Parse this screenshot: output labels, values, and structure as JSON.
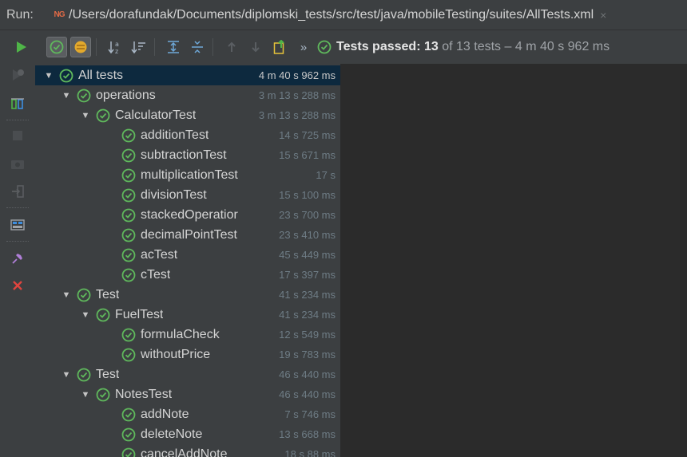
{
  "run_header": {
    "label": "Run:",
    "app_badge": "NG",
    "path": "/Users/dorafundak/Documents/diplomski_tests/src/test/java/mobileTesting/suites/AllTests.xml",
    "close_glyph": "×"
  },
  "toolbar": {
    "icons": [
      "run-icon",
      "show-passed-icon",
      "show-ignored-icon",
      "sort-alpha-icon",
      "sort-duration-icon",
      "expand-all-icon",
      "collapse-all-icon",
      "prev-failed-icon",
      "next-failed-icon",
      "export-icon",
      "more-icon"
    ],
    "more_glyph": "»",
    "status_prefix": "Tests passed:",
    "status_passed": "13",
    "status_suffix": "of 13 tests – 4 m 40 s 962 ms"
  },
  "gutter": {
    "icons": [
      "rerun-failed-icon",
      "toggle-auto-test-icon",
      "stop-icon",
      "screenshot-icon",
      "exit-icon",
      "layout-icon",
      "pin-icon",
      "close-icon"
    ]
  },
  "tree": {
    "rows": [
      {
        "level": 0,
        "arrow": "▼",
        "name": "All tests",
        "time": "4 m 40 s 962 ms",
        "selected": true
      },
      {
        "level": 1,
        "arrow": "▼",
        "name": "operations",
        "time": "3 m 13 s 288 ms"
      },
      {
        "level": 2,
        "arrow": "▼",
        "name": "CalculatorTest",
        "time": "3 m 13 s 288 ms"
      },
      {
        "level": 3,
        "arrow": "",
        "name": "additionTest",
        "time": "14 s 725 ms"
      },
      {
        "level": 3,
        "arrow": "",
        "name": "subtractionTest",
        "time": "15 s 671 ms"
      },
      {
        "level": 3,
        "arrow": "",
        "name": "multiplicationTest",
        "time": "17 s"
      },
      {
        "level": 3,
        "arrow": "",
        "name": "divisionTest",
        "time": "15 s 100 ms"
      },
      {
        "level": 3,
        "arrow": "",
        "name": "stackedOperatior",
        "time": "23 s 700 ms"
      },
      {
        "level": 3,
        "arrow": "",
        "name": "decimalPointTest",
        "time": "23 s 410 ms"
      },
      {
        "level": 3,
        "arrow": "",
        "name": "acTest",
        "time": "45 s 449 ms"
      },
      {
        "level": 3,
        "arrow": "",
        "name": "cTest",
        "time": "17 s 397 ms"
      },
      {
        "level": 1,
        "arrow": "▼",
        "name": "Test",
        "time": "41 s 234 ms"
      },
      {
        "level": 2,
        "arrow": "▼",
        "name": "FuelTest",
        "time": "41 s 234 ms"
      },
      {
        "level": 3,
        "arrow": "",
        "name": "formulaCheck",
        "time": "12 s 549 ms"
      },
      {
        "level": 3,
        "arrow": "",
        "name": "withoutPrice",
        "time": "19 s 783 ms"
      },
      {
        "level": 1,
        "arrow": "▼",
        "name": "Test",
        "time": "46 s 440 ms"
      },
      {
        "level": 2,
        "arrow": "▼",
        "name": "NotesTest",
        "time": "46 s 440 ms"
      },
      {
        "level": 3,
        "arrow": "",
        "name": "addNote",
        "time": "7 s 746 ms"
      },
      {
        "level": 3,
        "arrow": "",
        "name": "deleteNote",
        "time": "13 s 668 ms"
      },
      {
        "level": 3,
        "arrow": "",
        "name": "cancelAddNote",
        "time": "18 s 88 ms"
      }
    ]
  },
  "colors": {
    "pass_green": "#5fb85c",
    "selected_row": "#0d293e",
    "stop_red": "#e0443e"
  }
}
